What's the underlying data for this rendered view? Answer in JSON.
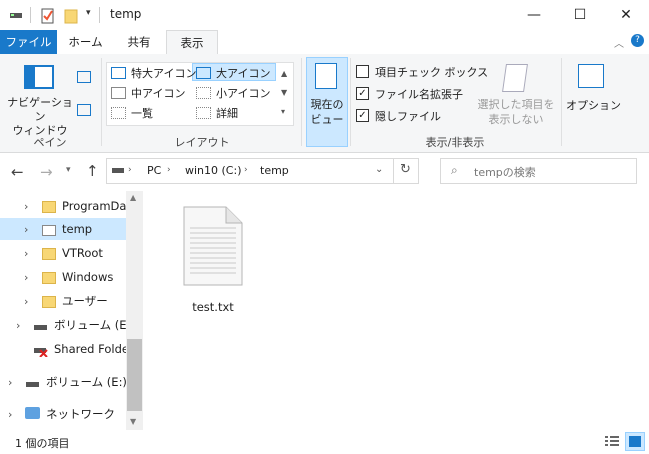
{
  "window": {
    "title": "temp"
  },
  "tabs": [
    {
      "label": "ファイル"
    },
    {
      "label": "ホーム"
    },
    {
      "label": "共有"
    },
    {
      "label": "表示"
    }
  ],
  "ribbon": {
    "pane": {
      "nav_pane_label": "ナビゲーション\nウィンドウ",
      "group_label": "ペイン"
    },
    "layout": {
      "items": [
        "特大アイコン",
        "大アイコン",
        "中アイコン",
        "小アイコン",
        "一覧",
        "詳細"
      ],
      "group_label": "レイアウト"
    },
    "current_view": {
      "label": "現在の\nビュー"
    },
    "show_hide": {
      "checkboxes": [
        {
          "label": "項目チェック ボックス",
          "checked": false
        },
        {
          "label": "ファイル名拡張子",
          "checked": true
        },
        {
          "label": "隠しファイル",
          "checked": true
        }
      ],
      "hide_selected_label": "選択した項目を\n表示しない",
      "group_label": "表示/非表示"
    },
    "options": {
      "label": "オプション"
    }
  },
  "address": {
    "crumbs": [
      "PC",
      "win10 (C:)",
      "temp"
    ]
  },
  "search": {
    "placeholder": "tempの検索"
  },
  "tree": [
    {
      "label": "ProgramDat"
    },
    {
      "label": "temp"
    },
    {
      "label": "VTRoot"
    },
    {
      "label": "Windows"
    },
    {
      "label": "ユーザー"
    },
    {
      "label": "ボリューム (E:)"
    },
    {
      "label": "Shared Folder"
    },
    {
      "label": "ボリューム (E:)"
    },
    {
      "label": "ネットワーク"
    }
  ],
  "files": [
    {
      "name": "test.txt"
    }
  ],
  "status": {
    "count": "1 個の項目"
  }
}
